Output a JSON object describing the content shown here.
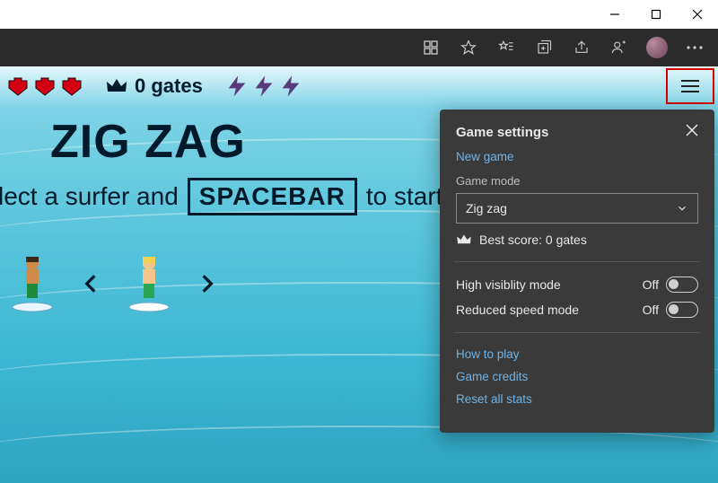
{
  "hud": {
    "hearts": 3,
    "gates_label": "0 gates",
    "boosts": 3
  },
  "title": "ZIG ZAG",
  "instruction": {
    "pre": "lect a surfer and",
    "key": "SPACEBAR",
    "post": "to start surfin"
  },
  "hamburger_icon": "menu-icon",
  "settings": {
    "title": "Game settings",
    "new_game": "New game",
    "mode_label": "Game mode",
    "mode_value": "Zig zag",
    "best_score": "Best score: 0 gates",
    "high_visibility": {
      "label": "High visiblity mode",
      "state": "Off"
    },
    "reduced_speed": {
      "label": "Reduced speed mode",
      "state": "Off"
    },
    "links": {
      "how_to_play": "How to play",
      "game_credits": "Game credits",
      "reset_stats": "Reset all stats"
    }
  }
}
